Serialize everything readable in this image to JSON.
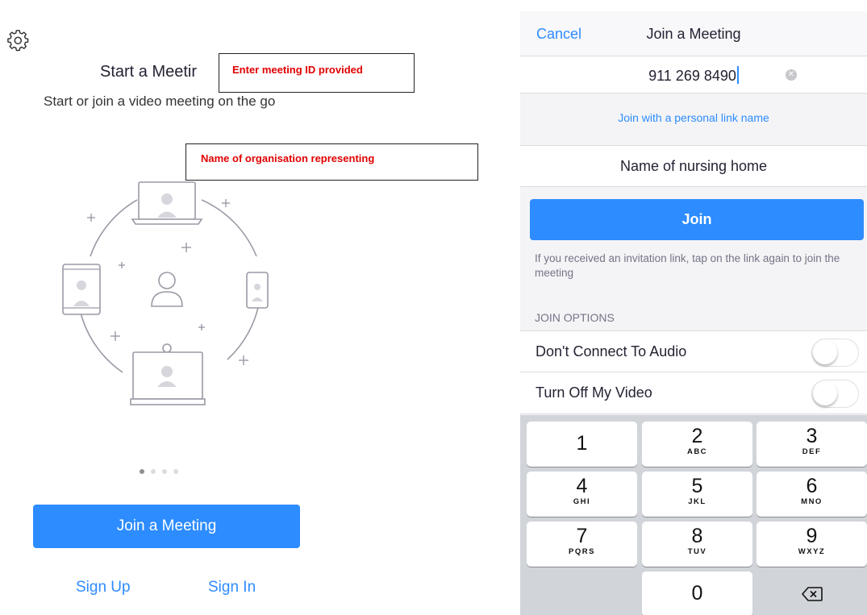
{
  "left_screen": {
    "title": "Start a Meetir",
    "subtitle": "Start or join a video meeting on the go",
    "annotations": {
      "meeting_id": "Enter meeting ID  provided",
      "organisation": "Name of organisation  representing"
    },
    "pager": {
      "count": 4,
      "active_index": 0
    },
    "join_button": "Join a Meeting",
    "sign_up": "Sign Up",
    "sign_in": "Sign In",
    "icons": [
      "gear-icon",
      "devices-illustration"
    ]
  },
  "right_screen": {
    "nav": {
      "cancel": "Cancel",
      "title": "Join a Meeting"
    },
    "meeting_id": {
      "value": "911 269 8490"
    },
    "personal_link": "Join with a personal link name",
    "name_field": {
      "value": "Name of nursing home"
    },
    "join_button": "Join",
    "hint": "If you received an invitation link, tap on the link again to join the meeting",
    "options_header": "JOIN OPTIONS",
    "options": [
      {
        "label": "Don't Connect To Audio",
        "on": false
      },
      {
        "label": "Turn Off My Video",
        "on": false
      }
    ],
    "keypad": [
      {
        "num": "1",
        "letters": ""
      },
      {
        "num": "2",
        "letters": "ABC"
      },
      {
        "num": "3",
        "letters": "DEF"
      },
      {
        "num": "4",
        "letters": "GHI"
      },
      {
        "num": "5",
        "letters": "JKL"
      },
      {
        "num": "6",
        "letters": "MNO"
      },
      {
        "num": "7",
        "letters": "PQRS"
      },
      {
        "num": "8",
        "letters": "TUV"
      },
      {
        "num": "9",
        "letters": "WXYZ"
      },
      {
        "num": "0",
        "letters": ""
      }
    ]
  },
  "colors": {
    "accent": "#2d8cff",
    "annotation_text": "#e00000"
  }
}
